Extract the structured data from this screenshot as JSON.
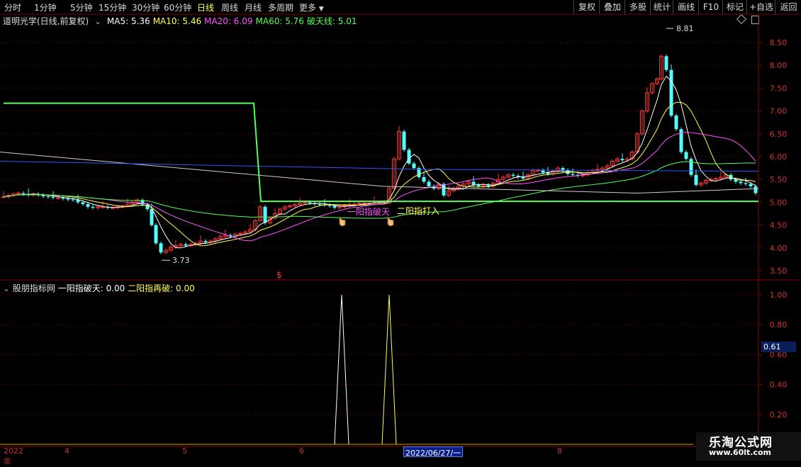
{
  "toolbar": {
    "periods": [
      "分时",
      "1分钟",
      "5分钟",
      "15分钟",
      "30分钟",
      "60分钟",
      "日线",
      "周线",
      "月线",
      "多周期",
      "更多"
    ],
    "active": "日线",
    "right_buttons": [
      "复权",
      "叠加",
      "多股",
      "统计",
      "画线",
      "F10",
      "标记",
      "+自选",
      "返回"
    ]
  },
  "stock": {
    "title": "道明光学(日线,前复权)",
    "ma": [
      {
        "label": "MA5: 5.36",
        "color": "#ffffff"
      },
      {
        "label": "MA10: 5.46",
        "color": "#ffff55"
      },
      {
        "label": "MA20: 6.09",
        "color": "#ff55ff"
      },
      {
        "label": "MA60: 5.76",
        "color": "#55ff55"
      },
      {
        "label": "破天线: 5.01",
        "color": "#55ff55"
      }
    ]
  },
  "price_axis": [
    "8.50",
    "8.00",
    "7.50",
    "7.00",
    "6.50",
    "6.00",
    "5.50",
    "5.00",
    "4.50",
    "4.00",
    "3.50"
  ],
  "annotations": {
    "high": "8.81",
    "low": "3.73",
    "signal1": "一阳指破天",
    "signal2": "二阳指打入",
    "s_marker": "$"
  },
  "indicator": {
    "name": "股朋指标网",
    "v1": "一阳指破天: 0.00",
    "v2": "二阳指再破: 0.00",
    "axis": [
      "1.00",
      "0.80",
      "0.60",
      "0.40",
      "0.20"
    ],
    "cursor_value": "0.61"
  },
  "date_axis": {
    "labels": [
      "2022年",
      "4",
      "5",
      "6",
      "8"
    ],
    "cursor": "2022/06/27/一"
  },
  "watermark": {
    "title": "乐淘公式网",
    "url": "www.60lt.com"
  },
  "colors": {
    "up": "#ff3232",
    "down": "#54fcfc",
    "grid": "#8b0000",
    "ma5": "#ffffff",
    "ma10": "#ffff55",
    "ma20": "#ff55ff",
    "ma60": "#55ff55",
    "breakline": "#55ff55",
    "blue_line": "#3355ff"
  }
}
